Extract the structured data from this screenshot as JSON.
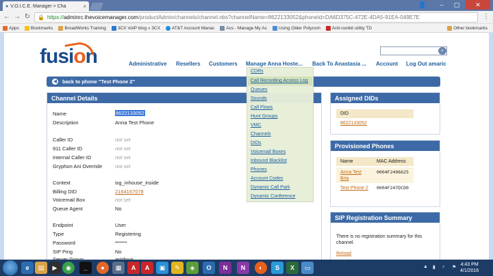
{
  "browser": {
    "tab_title": "V.O.I.C.E. Manager > Cha",
    "url_scheme": "https://",
    "url_host": "adminrc.thevoicemanager.com",
    "url_path": "/productAdmin/channels/channel.nbs?channelName=8622133052&phoneId=DA6D375C-472E-4DA5-91EA-049E7E",
    "bookmarks": [
      "Apps",
      "Bookmarks",
      "BroadWorks Training",
      "3CX VoIP blog » 3CX",
      "AT&T Account Manac",
      "Acs - Manage My Ac",
      "Using Older Polycom",
      "Anti-rootkit utility TD"
    ],
    "other_bookmarks": "Other bookmarks"
  },
  "nav": {
    "items": [
      "Administrative",
      "Resellers",
      "Customers",
      "Manage Anna Hoste...",
      "Back To Anastasia ...",
      "Account",
      "Log Out amaric"
    ]
  },
  "backbar": {
    "label": "back to phone \"Test Phone 2\""
  },
  "dropdown": {
    "items": [
      "CDRs",
      "Call Recording Access Log",
      "Queues",
      "Sounds",
      "Call Flows",
      "Hunt Groups",
      "VMC",
      "Channels",
      "DIDs",
      "Voicemail Boxes",
      "Inbound Blacklist",
      "Phones",
      "Account Codes",
      "Dynamic Call Park",
      "Dynamic Conference"
    ]
  },
  "channel": {
    "title": "Channel Details",
    "rows": [
      {
        "label": "Name",
        "value": "8622133052"
      },
      {
        "label": "Description",
        "value": "Anna Test Phone"
      },
      {
        "label": "Caller ID",
        "value": "not set"
      },
      {
        "label": "911 Caller ID",
        "value": "not set"
      },
      {
        "label": "Internal Caller ID",
        "value": "not set"
      },
      {
        "label": "Gryphon Ani Override",
        "value": "not set"
      },
      {
        "label": "Context",
        "value": "isg_inhouse_inside"
      },
      {
        "label": "Billing DID",
        "value": "2164167078"
      },
      {
        "label": "Voicemail Box",
        "value": "not set"
      },
      {
        "label": "Queue Agent",
        "value": "No"
      },
      {
        "label": "Endpoint",
        "value": "User"
      },
      {
        "label": "Type",
        "value": "Registering"
      },
      {
        "label": "Password",
        "value": "******"
      },
      {
        "label": "SIP Ping",
        "value": "No"
      },
      {
        "label": "Server Group",
        "value": "astdoug"
      }
    ]
  },
  "assigned_dids": {
    "title": "Assigned DIDs",
    "header": "DID",
    "value": "8622133052"
  },
  "provisioned": {
    "title": "Provisioned Phones",
    "headers": [
      "Name",
      "MAC Address"
    ],
    "rows": [
      {
        "name": "Anna Test Bria",
        "mac": "0004F2496625"
      },
      {
        "name": "Test Phone 2",
        "mac": "0004F247DCD0"
      }
    ]
  },
  "sip": {
    "title": "SIP Registration Summary",
    "message": "There is no registration summary for this channel.",
    "reload": "Reload"
  },
  "taskbar": {
    "time": "4:43 PM",
    "date": "4/1/2016"
  },
  "colors": {
    "header_blue": "#3d6aa6",
    "link_orange": "#c46a16",
    "nav_blue": "#1c5d9c",
    "dropdown_bg": "#e7efd8"
  }
}
